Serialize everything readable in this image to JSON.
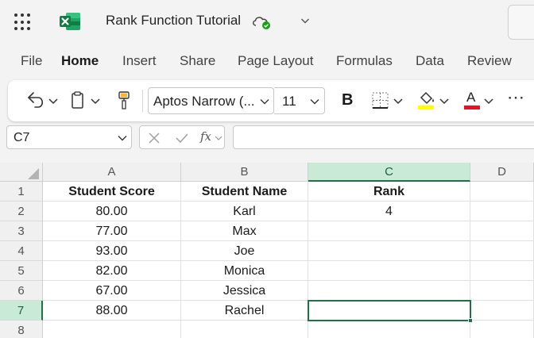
{
  "app": {
    "title": "Rank Function Tutorial",
    "icons": [
      "app-launcher-icon",
      "excel-logo-icon",
      "cloud-saved-icon",
      "chevron-down-icon"
    ]
  },
  "menu": {
    "items": [
      "File",
      "Home",
      "Insert",
      "Share",
      "Page Layout",
      "Formulas",
      "Data",
      "Review"
    ],
    "active": "Home"
  },
  "ribbon": {
    "font_name": "Aptos Narrow (...",
    "font_size": "11",
    "bold_label": "B",
    "font_color_label": "A",
    "more_label": "⋯",
    "colors": {
      "fill_highlight": "#ffff00",
      "font_color": "#e81123"
    },
    "icons": [
      "undo-icon",
      "clipboard-icon",
      "format-painter-icon",
      "borders-icon",
      "fill-color-icon",
      "font-color-icon",
      "more-icon"
    ]
  },
  "formula_bar": {
    "name_box": "C7",
    "fx_label": "fx",
    "formula": ""
  },
  "sheet": {
    "columns": [
      "A",
      "B",
      "C",
      "D"
    ],
    "selected_column": "C",
    "selected_row": "7",
    "rows": [
      {
        "num": "1",
        "cells": [
          "Student Score",
          "Student Name",
          "Rank",
          ""
        ]
      },
      {
        "num": "2",
        "cells": [
          "80.00",
          "Karl",
          "4",
          ""
        ]
      },
      {
        "num": "3",
        "cells": [
          "77.00",
          "Max",
          "",
          ""
        ]
      },
      {
        "num": "4",
        "cells": [
          "93.00",
          "Joe",
          "",
          ""
        ]
      },
      {
        "num": "5",
        "cells": [
          "82.00",
          "Monica",
          "",
          ""
        ]
      },
      {
        "num": "6",
        "cells": [
          "67.00",
          "Jessica",
          "",
          ""
        ]
      },
      {
        "num": "7",
        "cells": [
          "88.00",
          "Rachel",
          "",
          ""
        ]
      },
      {
        "num": "8",
        "cells": [
          "",
          "",
          "",
          ""
        ]
      }
    ]
  },
  "colors": {
    "excel_green": "#1e7145",
    "header_selected": "#caead8"
  }
}
